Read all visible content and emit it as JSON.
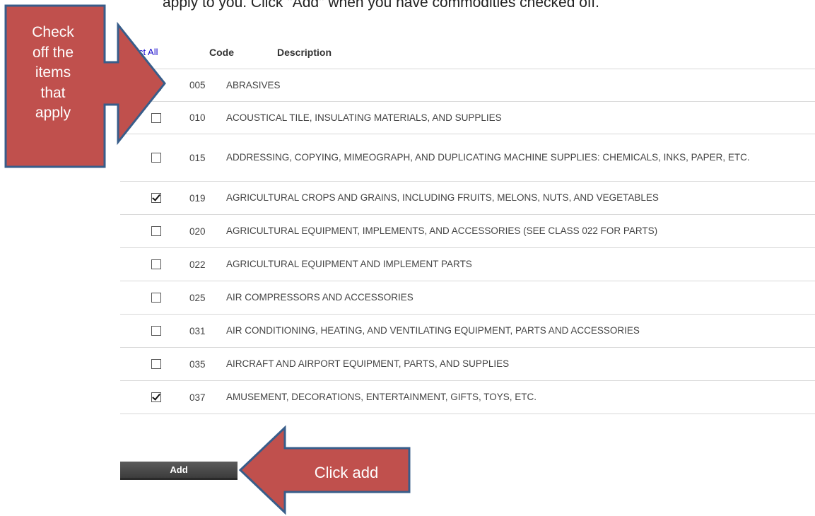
{
  "instruction": "apply to you. Click \"Add\" when you have commodities checked off.",
  "table": {
    "select_all": "Select All",
    "col_code": "Code",
    "col_desc": "Description",
    "rows": [
      {
        "code": "005",
        "desc": "ABRASIVES",
        "checked": true
      },
      {
        "code": "010",
        "desc": "ACOUSTICAL TILE, INSULATING MATERIALS, AND SUPPLIES",
        "checked": false
      },
      {
        "code": "015",
        "desc": "ADDRESSING, COPYING, MIMEOGRAPH, AND DUPLICATING MACHINE SUPPLIES: CHEMICALS, INKS, PAPER, ETC.",
        "checked": false
      },
      {
        "code": "019",
        "desc": "AGRICULTURAL CROPS AND GRAINS, INCLUDING FRUITS, MELONS, NUTS, AND VEGETABLES",
        "checked": true
      },
      {
        "code": "020",
        "desc": "AGRICULTURAL EQUIPMENT, IMPLEMENTS, AND ACCESSORIES (SEE CLASS 022 FOR PARTS)",
        "checked": false
      },
      {
        "code": "022",
        "desc": "AGRICULTURAL EQUIPMENT AND IMPLEMENT PARTS",
        "checked": false
      },
      {
        "code": "025",
        "desc": "AIR COMPRESSORS AND ACCESSORIES",
        "checked": false
      },
      {
        "code": "031",
        "desc": "AIR CONDITIONING, HEATING, AND VENTILATING EQUIPMENT, PARTS AND ACCESSORIES",
        "checked": false
      },
      {
        "code": "035",
        "desc": "AIRCRAFT AND AIRPORT EQUIPMENT, PARTS, AND SUPPLIES",
        "checked": false
      },
      {
        "code": "037",
        "desc": "AMUSEMENT, DECORATIONS, ENTERTAINMENT, GIFTS, TOYS, ETC.",
        "checked": true
      }
    ]
  },
  "add_label": "Add",
  "callouts": {
    "check_lines": [
      "Check",
      "off the",
      "items",
      "that",
      "apply"
    ],
    "click_add": "Click add"
  },
  "colors": {
    "callout_fill": "#c0504d",
    "callout_border": "#385d8a",
    "link": "#1a0dcc"
  }
}
